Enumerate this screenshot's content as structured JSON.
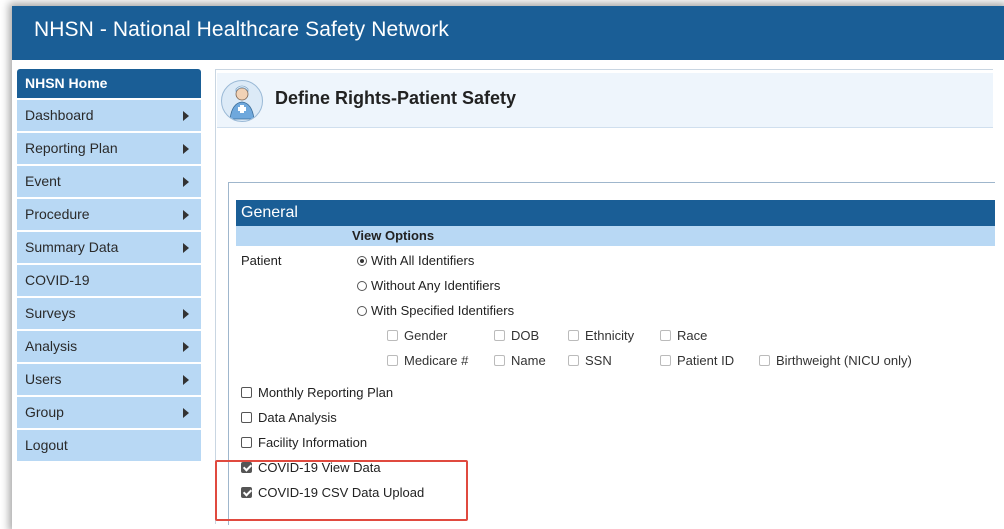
{
  "app": {
    "title": "NHSN - National Healthcare Safety Network"
  },
  "sidebar": {
    "header": "NHSN Home",
    "items": [
      {
        "label": "Dashboard",
        "arrow": true
      },
      {
        "label": "Reporting Plan",
        "arrow": true
      },
      {
        "label": "Event",
        "arrow": true
      },
      {
        "label": "Procedure",
        "arrow": true
      },
      {
        "label": "Summary Data",
        "arrow": true
      },
      {
        "label": "COVID-19",
        "arrow": false
      },
      {
        "label": "Surveys",
        "arrow": true
      },
      {
        "label": "Analysis",
        "arrow": true
      },
      {
        "label": "Users",
        "arrow": true
      },
      {
        "label": "Group",
        "arrow": true
      },
      {
        "label": "Logout",
        "arrow": false
      }
    ]
  },
  "page": {
    "title": "Define Rights-Patient Safety",
    "icon": "nurse-icon"
  },
  "general": {
    "section_title": "General",
    "view_options_header": "View Options",
    "patient_label": "Patient",
    "radios": [
      {
        "label": "With All Identifiers",
        "selected": true
      },
      {
        "label": "Without Any Identifiers",
        "selected": false
      },
      {
        "label": "With Specified Identifiers",
        "selected": false
      }
    ],
    "identifiers_row1": [
      "Gender",
      "DOB",
      "Ethnicity",
      "Race"
    ],
    "identifiers_row2": [
      "Medicare #",
      "Name",
      "SSN",
      "Patient ID",
      "Birthweight (NICU only)"
    ],
    "checkboxes": [
      {
        "label": "Monthly Reporting Plan",
        "checked": false
      },
      {
        "label": "Data Analysis",
        "checked": false
      },
      {
        "label": "Facility Information",
        "checked": false
      },
      {
        "label": "COVID-19 View Data",
        "checked": true
      },
      {
        "label": "COVID-19 CSV Data Upload",
        "checked": true
      }
    ]
  },
  "colors": {
    "brand_blue": "#1a5e96",
    "sidebar_light_blue": "#b8d8f4",
    "highlight_red": "#e04a3f"
  }
}
